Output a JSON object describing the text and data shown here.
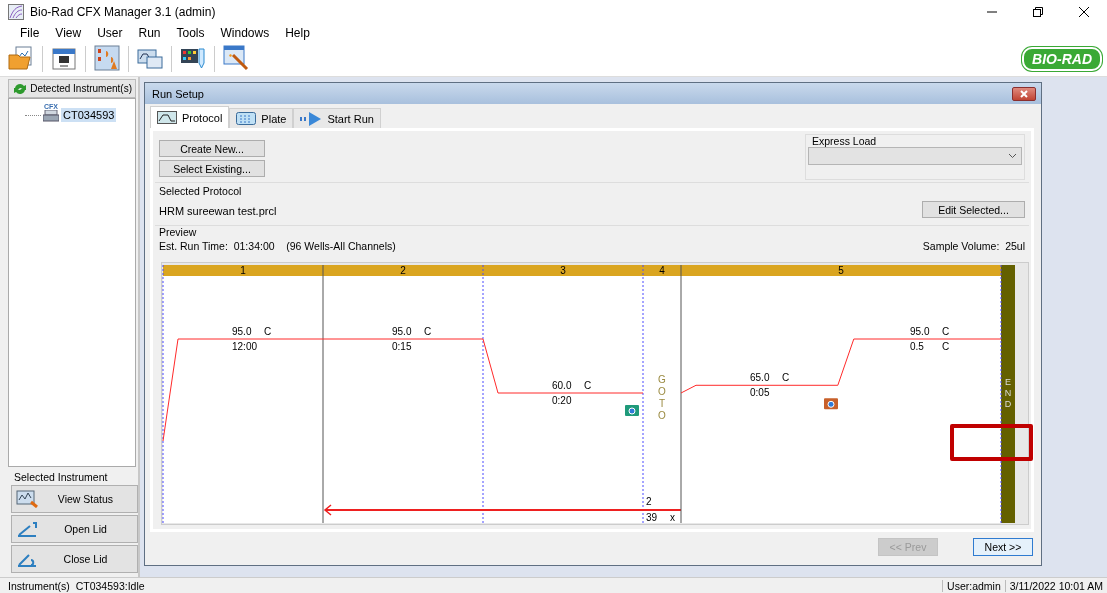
{
  "window": {
    "title": "Bio-Rad CFX Manager 3.1 (admin)"
  },
  "menu": [
    "File",
    "View",
    "User",
    "Run",
    "Tools",
    "Windows",
    "Help"
  ],
  "toolbar": {
    "logo": "BIO-RAD"
  },
  "instruments_panel": {
    "header": "Detected Instrument(s)",
    "tree": [
      {
        "label": "CT034593",
        "badge": "CFX",
        "selected": true
      }
    ]
  },
  "selected_instrument": {
    "title": "Selected Instrument",
    "buttons": [
      {
        "label": "View Status",
        "kind": "status"
      },
      {
        "label": "Open Lid",
        "kind": "open"
      },
      {
        "label": "Close Lid",
        "kind": "close"
      }
    ]
  },
  "run_setup": {
    "title": "Run Setup",
    "tabs": [
      {
        "label": "Protocol",
        "kind": "protocol",
        "selected": true
      },
      {
        "label": "Plate",
        "kind": "plate",
        "selected": false
      },
      {
        "label": "Start Run",
        "kind": "start",
        "selected": false
      }
    ],
    "create_button": "Create New...",
    "select_button": "Select Existing...",
    "express_load": {
      "label": "Express Load"
    },
    "selected_protocol": {
      "label": "Selected Protocol",
      "file": "HRM sureewan test.prcl",
      "edit_button": "Edit Selected..."
    },
    "preview": {
      "label": "Preview",
      "run_time": "Est. Run Time:  01:34:00",
      "wells": "(96 Wells-All Channels)",
      "sample_volume": "Sample Volume:  25ul"
    },
    "protocol": {
      "steps": [
        {
          "number": "1",
          "kind": "hold",
          "temp": "95.0",
          "unit": "C",
          "time": "12:00",
          "camera": false
        },
        {
          "number": "2",
          "kind": "hold",
          "temp": "95.0",
          "unit": "C",
          "time": "0:15",
          "camera": false
        },
        {
          "number": "3",
          "kind": "hold",
          "temp": "60.0",
          "unit": "C",
          "time": "0:20",
          "camera": true
        },
        {
          "number": "4",
          "kind": "goto",
          "label": "GOTO",
          "target": "2",
          "cycles": "39",
          "cycles_unit": "x"
        },
        {
          "number": "5",
          "kind": "melt",
          "temp": "65.0",
          "unit": "C",
          "time": "0:05",
          "end_temp": "95.0",
          "end_unit": "C",
          "increment": "0.5",
          "increment_unit": "C",
          "camera": true
        }
      ],
      "end": "END"
    },
    "nav": [
      {
        "label": "<< Prev",
        "disabled": true
      },
      {
        "label": "Next >>",
        "disabled": false
      }
    ]
  },
  "status_bar": {
    "instrument": "Instrument(s)  CT034593:Idle",
    "user": "User:admin",
    "datetime": "3/11/2022 10:01 AM"
  }
}
